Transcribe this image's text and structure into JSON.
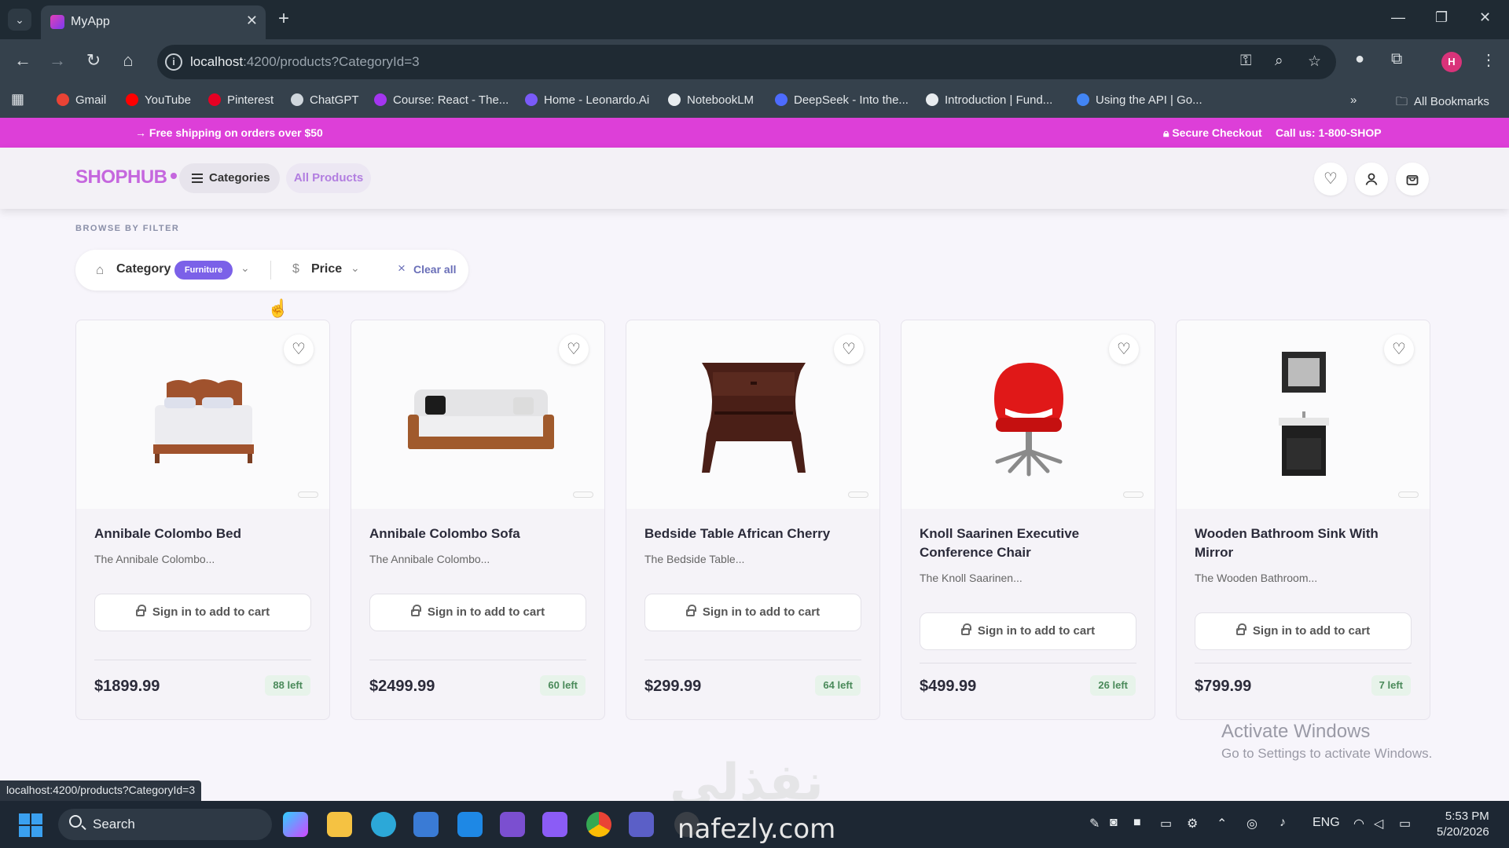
{
  "browser": {
    "tab_title": "MyApp",
    "url_host": "localhost",
    "url_rest": ":4200/products?CategoryId=3",
    "bookmarks": [
      {
        "label": "Gmail",
        "color": "#ea4335"
      },
      {
        "label": "YouTube",
        "color": "#ff0000"
      },
      {
        "label": "Pinterest",
        "color": "#e60023"
      },
      {
        "label": "ChatGPT",
        "color": "#cfd6dc"
      },
      {
        "label": "Course: React - The...",
        "color": "#a435f0"
      },
      {
        "label": "Home - Leonardo.Ai",
        "color": "#7a5af8"
      },
      {
        "label": "NotebookLM",
        "color": "#e8ecef"
      },
      {
        "label": "DeepSeek - Into the...",
        "color": "#4d6bfe"
      },
      {
        "label": "Introduction | Fund...",
        "color": "#e8ecef"
      },
      {
        "label": "Using the API  |  Go...",
        "color": "#4285f4"
      }
    ],
    "all_bookmarks": "All Bookmarks",
    "profile_initial": "H",
    "status_url": "localhost:4200/products?CategoryId=3"
  },
  "promo": {
    "shipping": "Free shipping on orders over $50",
    "secure": "Secure Checkout",
    "call": "Call us: 1-800-SHOP"
  },
  "header": {
    "logo": "SHOPHUB",
    "categories_label": "Categories",
    "all_products_label": "All Products"
  },
  "filters": {
    "section_label": "BROWSE BY FILTER",
    "category_label": "Category",
    "category_value": "Furniture",
    "price_label": "Price",
    "clear_label": "Clear all"
  },
  "cart_button_label": "Sign in to add to cart",
  "products": [
    {
      "name": "Annibale Colombo Bed",
      "desc": "The Annibale Colombo...",
      "price": "$1899.99",
      "stock": "88 left"
    },
    {
      "name": "Annibale Colombo Sofa",
      "desc": "The Annibale Colombo...",
      "price": "$2499.99",
      "stock": "60 left"
    },
    {
      "name": "Bedside Table African Cherry",
      "desc": "The Bedside Table...",
      "price": "$299.99",
      "stock": "64 left"
    },
    {
      "name": "Knoll Saarinen Executive Conference Chair",
      "desc": "The Knoll Saarinen...",
      "price": "$499.99",
      "stock": "26 left"
    },
    {
      "name": "Wooden Bathroom Sink With Mirror",
      "desc": "The Wooden Bathroom...",
      "price": "$799.99",
      "stock": "7 left"
    }
  ],
  "watermark": {
    "line1": "Activate Windows",
    "line2": "Go to Settings to activate Windows."
  },
  "overlay": {
    "arabic": "نفذلي",
    "site": "nafezly.com"
  },
  "taskbar": {
    "search_placeholder": "Search",
    "lang": "ENG",
    "time": "5:53 PM",
    "date": "5/20/2026"
  },
  "colors": {
    "brand": "#c567de",
    "promo_bg": "#dd3fd8",
    "badge": "#7b61e8",
    "stock_text": "#4a8a5a"
  }
}
